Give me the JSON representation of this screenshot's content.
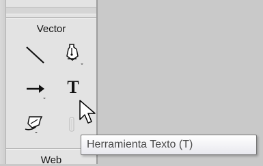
{
  "panel": {
    "section_vector": "Vector",
    "section_web": "Web",
    "tools": [
      {
        "name": "line-tool",
        "icon": "line-icon"
      },
      {
        "name": "pen-tool",
        "icon": "pen-icon"
      },
      {
        "name": "pointer-tool",
        "icon": "arrow-right-icon"
      },
      {
        "name": "text-tool",
        "icon": "text-t-icon",
        "glyph": "T"
      },
      {
        "name": "freeform-tool",
        "icon": "freeform-pen-icon"
      },
      {
        "name": "knife-tool",
        "icon": "knife-icon"
      }
    ]
  },
  "tooltip": {
    "text": "Herramienta Texto (T)"
  },
  "colors": {
    "panel_bg": "#e3e3e3",
    "workspace_bg": "#c9c9c9",
    "tooltip_border": "#767676"
  }
}
